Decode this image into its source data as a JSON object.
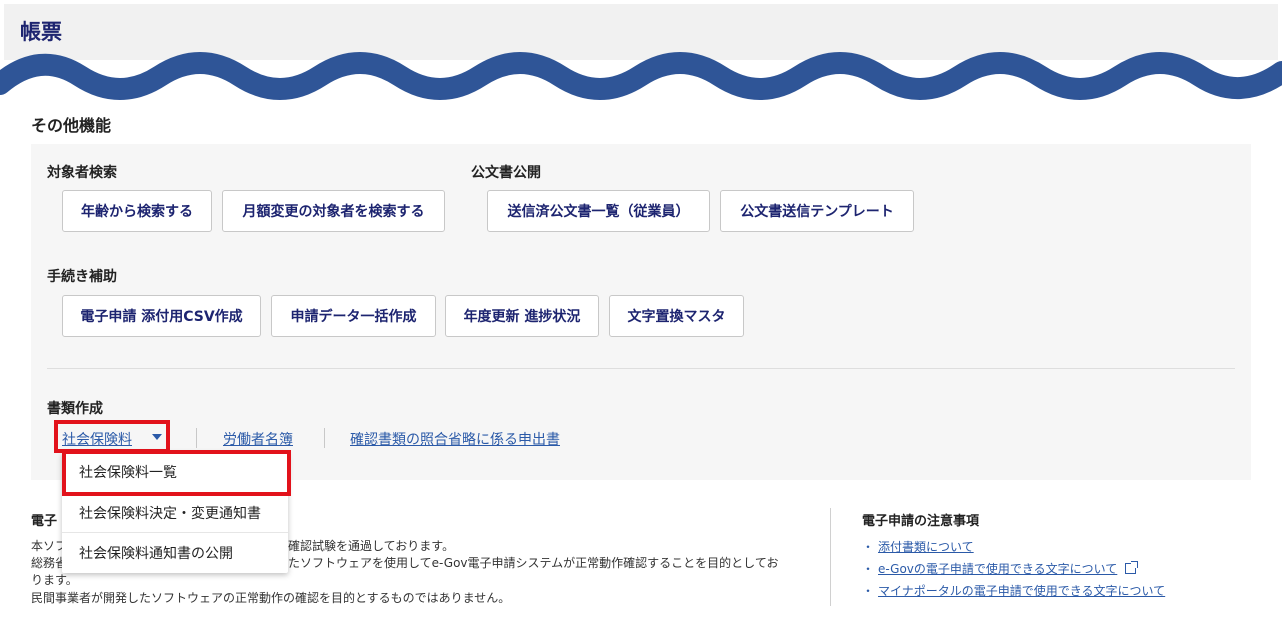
{
  "header": {
    "title": "帳票"
  },
  "section": {
    "title": "その他機能"
  },
  "groups": {
    "search": {
      "label": "対象者検索",
      "buttons": [
        "年齢から検索する",
        "月額変更の対象者を検索する"
      ]
    },
    "publish": {
      "label": "公文書公開",
      "buttons": [
        "送信済公文書一覧（従業員）",
        "公文書送信テンプレート"
      ]
    },
    "support": {
      "label": "手続き補助",
      "buttons": [
        "電子申請 添付用CSV作成",
        "申請データ一括作成",
        "年度更新 進捗状況",
        "文字置換マスタ"
      ]
    },
    "documents": {
      "label": "書類作成",
      "links": [
        "社会保険料",
        "労働者名簿",
        "確認書類の照合省略に係る申出書"
      ]
    }
  },
  "dropdown": {
    "items": [
      "社会保険料一覧",
      "社会保険料決定・変更通知書",
      "社会保険料通知書の公開"
    ]
  },
  "footer": {
    "left": {
      "title": "電子",
      "lines": [
        "本ソフ",
        "確認試験を通過しております。",
        "総務省",
        "たソフトウェアを使用してe-Gov電子申請システムが正常動作確認することを目的としてお",
        "ります。",
        "民間事業者が開発したソフトウェアの正常動作の確認を目的とするものではありません。"
      ]
    },
    "right": {
      "title": "電子申請の注意事項",
      "links": [
        "添付書類について",
        "e-Govの電子申請で使用できる文字について",
        "マイナポータルの電子申請で使用できる文字について"
      ],
      "bullet": "・"
    }
  },
  "colors": {
    "wave": "#2f5597",
    "highlight": "#e2121b",
    "brand": "#1d2470",
    "link": "#2b5aa8"
  }
}
